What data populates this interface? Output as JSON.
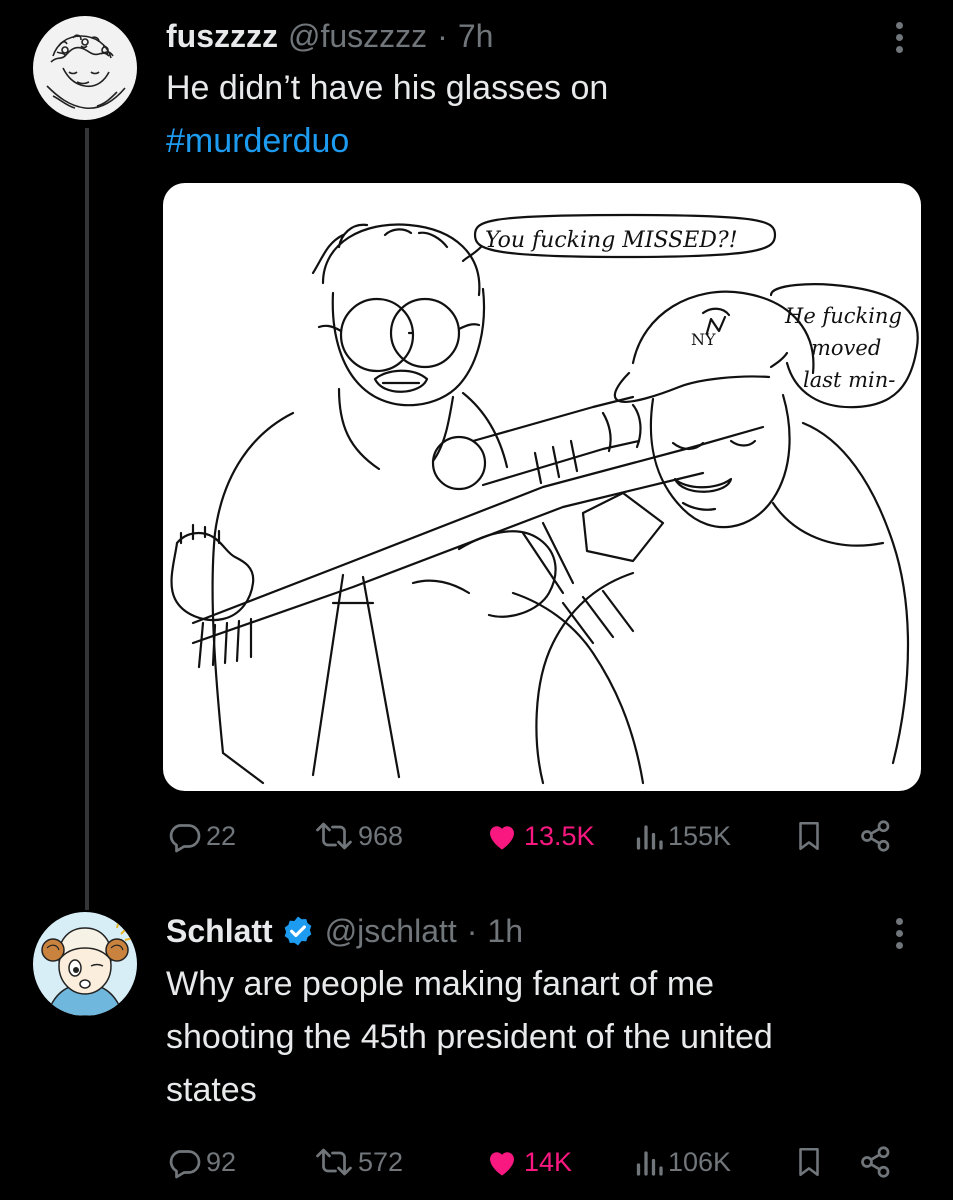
{
  "colors": {
    "background": "#000000",
    "text": "#e7e9ea",
    "muted": "#71767b",
    "link": "#1d9bf0",
    "like": "#f91880",
    "verified": "#1d9bf0"
  },
  "tweet1": {
    "name": "fuszzzz",
    "handle": "@fuszzzz",
    "sep": "·",
    "time": "7h",
    "text": "He didn’t have his glasses on",
    "hashtag": "#murderduo",
    "image": {
      "bubble1": "You fucking MISSED?!",
      "bubble2_line1": "He fucking",
      "bubble2_line2": "moved",
      "bubble2_line3": "last min-",
      "cap_logo": "NY"
    },
    "actions": {
      "replies": "22",
      "reposts": "968",
      "likes": "13.5K",
      "views": "155K"
    }
  },
  "tweet2": {
    "name": "Schlatt",
    "handle": "@jschlatt",
    "sep": "·",
    "time": "1h",
    "text_line1": "Why are people making fanart of me",
    "text_line2": "shooting the 45th president of the united",
    "text_line3": "states",
    "actions": {
      "replies": "92",
      "reposts": "572",
      "likes": "14K",
      "views": "106K"
    }
  },
  "icons": [
    "reply-icon",
    "repost-icon",
    "heart-icon",
    "views-icon",
    "bookmark-icon",
    "share-icon",
    "more-icon",
    "verified-icon"
  ]
}
